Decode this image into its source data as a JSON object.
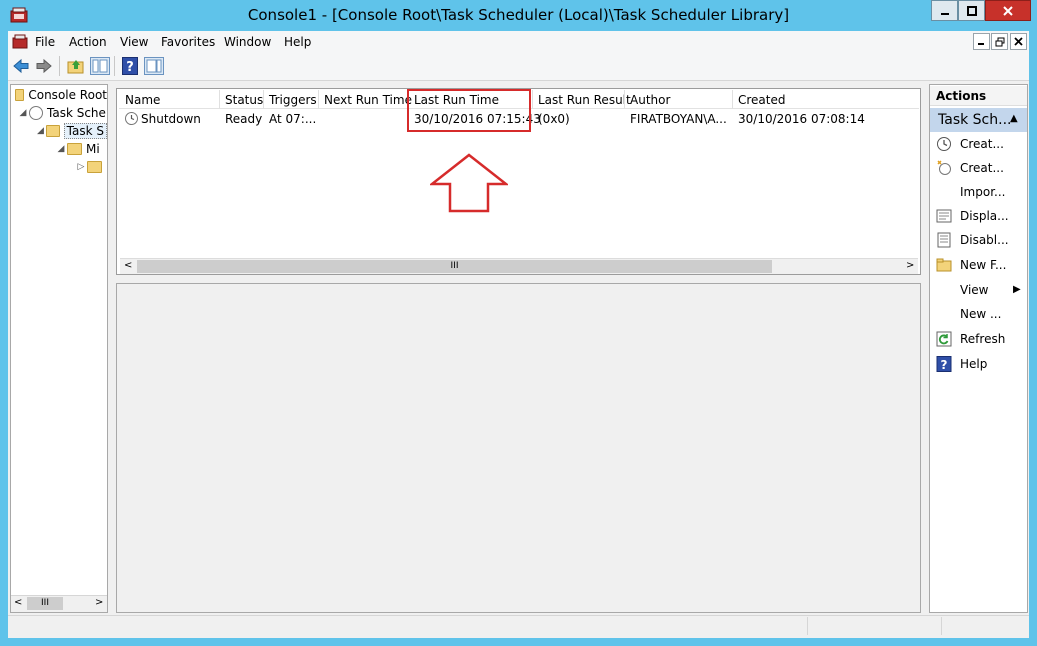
{
  "window": {
    "title": "Console1 - [Console Root\\Task Scheduler (Local)\\Task Scheduler Library]"
  },
  "menu": [
    "File",
    "Action",
    "View",
    "Favorites",
    "Window",
    "Help"
  ],
  "tree": {
    "items": [
      {
        "label": "Console Root",
        "icon": "folder-icon"
      },
      {
        "label": "Task Sche",
        "icon": "clock-icon",
        "expanded": true
      },
      {
        "label": "Task S",
        "icon": "clock-folder-icon",
        "expanded": true,
        "selected": true
      },
      {
        "label": "Mi",
        "icon": "folder-icon",
        "expanded": true
      },
      {
        "label": "",
        "icon": "folder-icon",
        "expanded": false
      }
    ],
    "scroll_label": "III"
  },
  "list": {
    "columns": [
      "Name",
      "Status",
      "Triggers",
      "Next Run Time",
      "Last Run Time",
      "Last Run Result",
      "Author",
      "Created"
    ],
    "rows": [
      {
        "name": "Shutdown",
        "status": "Ready",
        "triggers": "At 07:...",
        "next_run_time": "",
        "last_run_time": "30/10/2016 07:15:43",
        "last_run_result": "(0x0)",
        "author": "FIRATBOYAN\\A...",
        "created": "30/10/2016 07:08:14"
      }
    ],
    "scroll_label": "III"
  },
  "actions": {
    "title": "Actions",
    "section": "Task Sch...",
    "items": [
      {
        "label": "Creat...",
        "icon": "clock-icon"
      },
      {
        "label": "Creat...",
        "icon": "new-task-icon"
      },
      {
        "label": "Impor...",
        "icon": ""
      },
      {
        "label": "Displa...",
        "icon": "display-icon"
      },
      {
        "label": "Disabl...",
        "icon": "disable-icon"
      },
      {
        "label": "New F...",
        "icon": "folder-icon"
      },
      {
        "label": "View",
        "icon": "",
        "submenu": true
      },
      {
        "label": "New ...",
        "icon": ""
      },
      {
        "label": "Refresh",
        "icon": "refresh-icon"
      },
      {
        "label": "Help",
        "icon": "help-icon"
      }
    ]
  },
  "colors": {
    "titlebar": "#5fc3ea",
    "close_button": "#c7312a",
    "highlight": "#d62b2b",
    "section_header": "#c3d6ec"
  }
}
